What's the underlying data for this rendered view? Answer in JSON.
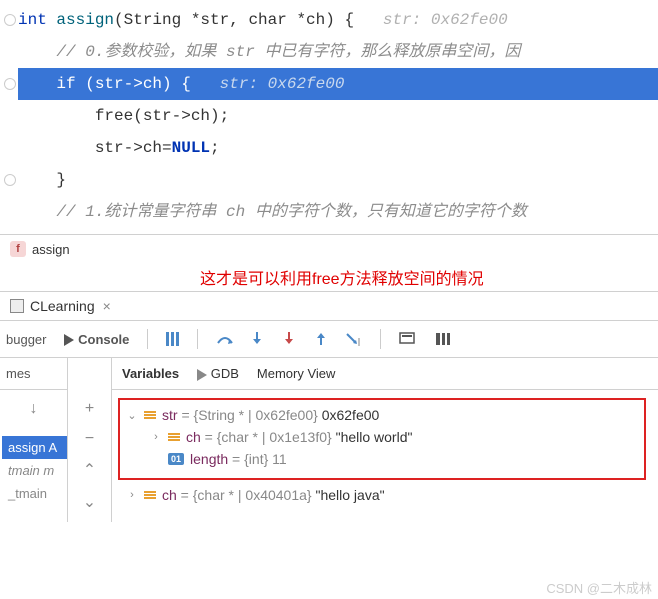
{
  "code": {
    "l1_pre": "int ",
    "l1_func": "assign",
    "l1_params": "(String *str, char *ch) {",
    "l1_hint": "   str: 0x62fe00",
    "l2": "    // 0.参数校验，如果 str 中已有字符，那么释放原串空间，因",
    "l3_code": "    if (str->ch) {",
    "l3_hint": "   str: 0x62fe00",
    "l4": "        free(str->ch);",
    "l5_pre": "        str->ch=",
    "l5_null": "NULL",
    "l5_post": ";",
    "l6": "    }",
    "l7": "",
    "l8": "    // 1.统计常量字符串 ch 中的字符个数，只有知道它的字符个数"
  },
  "breadcrumb": {
    "badge": "f",
    "name": "assign"
  },
  "annotation": "这才是可以利用free方法释放空间的情况",
  "project": {
    "name": "CLearning"
  },
  "toolbar": {
    "debugger": "bugger",
    "console": "Console"
  },
  "frames": {
    "label": "mes"
  },
  "vars_panel": {
    "variables": "Variables",
    "gdb": "GDB",
    "memory": "Memory View"
  },
  "tree": {
    "str_name": "str",
    "str_type": " = {String * | 0x62fe00} ",
    "str_val": "0x62fe00",
    "ch1_name": "ch",
    "ch1_type": " = {char * | 0x1e13f0} ",
    "ch1_val": "\"hello world\"",
    "len_badge": "01",
    "len_name": "length",
    "len_rest": " = {int} 11",
    "ch2_name": "ch",
    "ch2_type": " = {char * | 0x40401a} ",
    "ch2_val": "\"hello java\""
  },
  "stack": {
    "item1": "assign A",
    "item2": "tmain m",
    "item3": "_tmain"
  },
  "watermark": "CSDN @二木成林"
}
